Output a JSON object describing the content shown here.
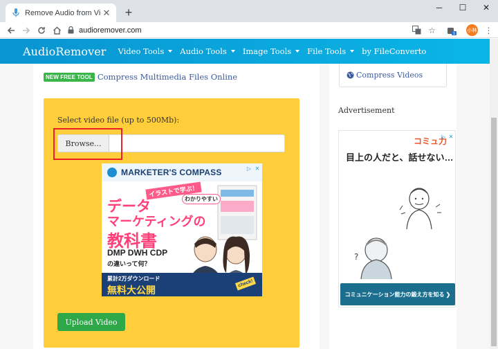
{
  "browser": {
    "tab_title": "Remove Audio from Video Onli",
    "url": "audioremover.com",
    "profile_initials": "小林",
    "extension_badge": "1"
  },
  "site": {
    "logo": "AudioRemover",
    "nav": [
      {
        "label": "Video Tools",
        "has_caret": true
      },
      {
        "label": "Audio Tools",
        "has_caret": true
      },
      {
        "label": "Image Tools",
        "has_caret": true
      },
      {
        "label": "File Tools",
        "has_caret": true
      },
      {
        "label": "by FileConverto",
        "has_caret": false
      }
    ]
  },
  "main": {
    "badge": "NEW FREE TOOL",
    "new_tool_link": "Compress Multimedia Files Online",
    "select_label": "Select video file (up to 500Mb):",
    "browse_label": "Browse...",
    "upload_label": "Upload Video",
    "ad": {
      "brand": "MARKETER'S COMPASS",
      "tag1": "イラストで学ぶ！",
      "tag2": "わかりやすい",
      "line1": "データ",
      "line2": "マーケティングの",
      "line3": "教科書",
      "line4": "DMP DWH CDP",
      "line5": "の違いって何？",
      "foot1": "累計2万ダウンロード",
      "foot2": "無料大公開",
      "check": "check!"
    }
  },
  "sidebar": {
    "compress_link": "Compress Videos",
    "advertisement_label": "Advertisement",
    "ad": {
      "brand": "コミュ力",
      "title": "目上の人だと、話せない…",
      "footer": "コミュニケーション能力の鍛え方を知る ❯"
    }
  },
  "colors": {
    "nav_gradient_start": "#0a94d0",
    "panel_bg": "#ffce3a",
    "upload_button": "#2fa84a",
    "highlight_border": "#e8202a",
    "badge_green": "#3ab54a",
    "link_blue": "#3b5a9d"
  }
}
